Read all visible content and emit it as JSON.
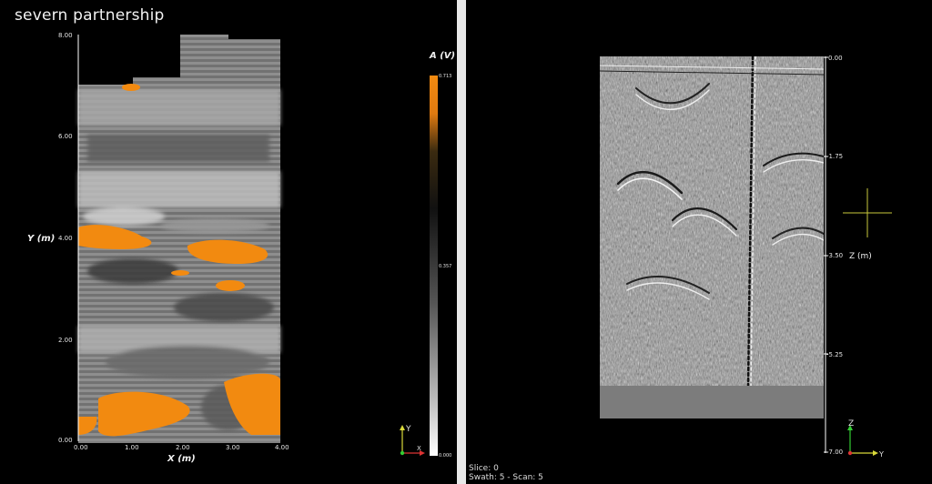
{
  "brand": "severn partnership",
  "plan_view": {
    "y_axis_label": "Y (m)",
    "x_axis_label": "X (m)",
    "y_ticks": [
      "8.00",
      "6.00",
      "4.00",
      "2.00",
      "0.00"
    ],
    "x_ticks": [
      "0.00",
      "1.00",
      "2.00",
      "3.00",
      "4.00"
    ],
    "colorbar": {
      "title": "A (V)",
      "max_label": "0.713",
      "mid_label": "0.357",
      "min_label": "0.000",
      "high_color": "#f28a10",
      "low_color": "#ffffff"
    },
    "orientation": {
      "y": "Y",
      "x": "X"
    }
  },
  "section_view": {
    "z_axis_label": "Z (m)",
    "z_ticks": [
      "0.00",
      "-1.75",
      "-3.50",
      "-5.25",
      "-7.00"
    ],
    "orientation": {
      "z": "Z",
      "y": "Y"
    },
    "crosshair_color": "#c8c83c"
  },
  "status": {
    "slice": "Slice:  0",
    "swath_scan": "Swath: 5 - Scan: 5"
  },
  "colors": {
    "anomaly": "#f28a10",
    "background": "#000000",
    "divider": "#e8e8e8"
  }
}
